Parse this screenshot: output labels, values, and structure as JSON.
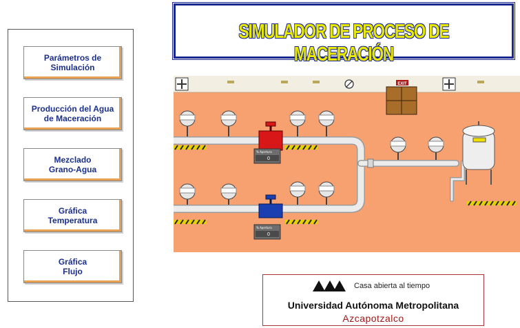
{
  "title": "SIMULADOR DE PROCESO DE MACERACIÓN",
  "nav": {
    "parametros": [
      "Parámetros de",
      "Simulación"
    ],
    "produccion": [
      "Producción del Agua",
      "de Maceración"
    ],
    "mezclado": [
      "Mezclado",
      "Grano-Agua"
    ],
    "grafica_temp": [
      "Gráfica",
      "Temperatura"
    ],
    "grafica_flujo": [
      "Gráfica",
      "Flujo"
    ]
  },
  "process": {
    "exit_sign": "EXIT",
    "valve_red": {
      "label": "% Apertura",
      "value": "0"
    },
    "valve_blue": {
      "label": "% Apertura",
      "value": "0"
    },
    "colors": {
      "floor": "#f7a070",
      "pipe": "#e8e8e8",
      "valve_red": "#d81818",
      "valve_blue": "#1a3fb0"
    }
  },
  "footer": {
    "tagline": "Casa abierta al tiempo",
    "university": "Universidad Autónoma Metropolitana",
    "campus": "Azcapotzalco"
  }
}
